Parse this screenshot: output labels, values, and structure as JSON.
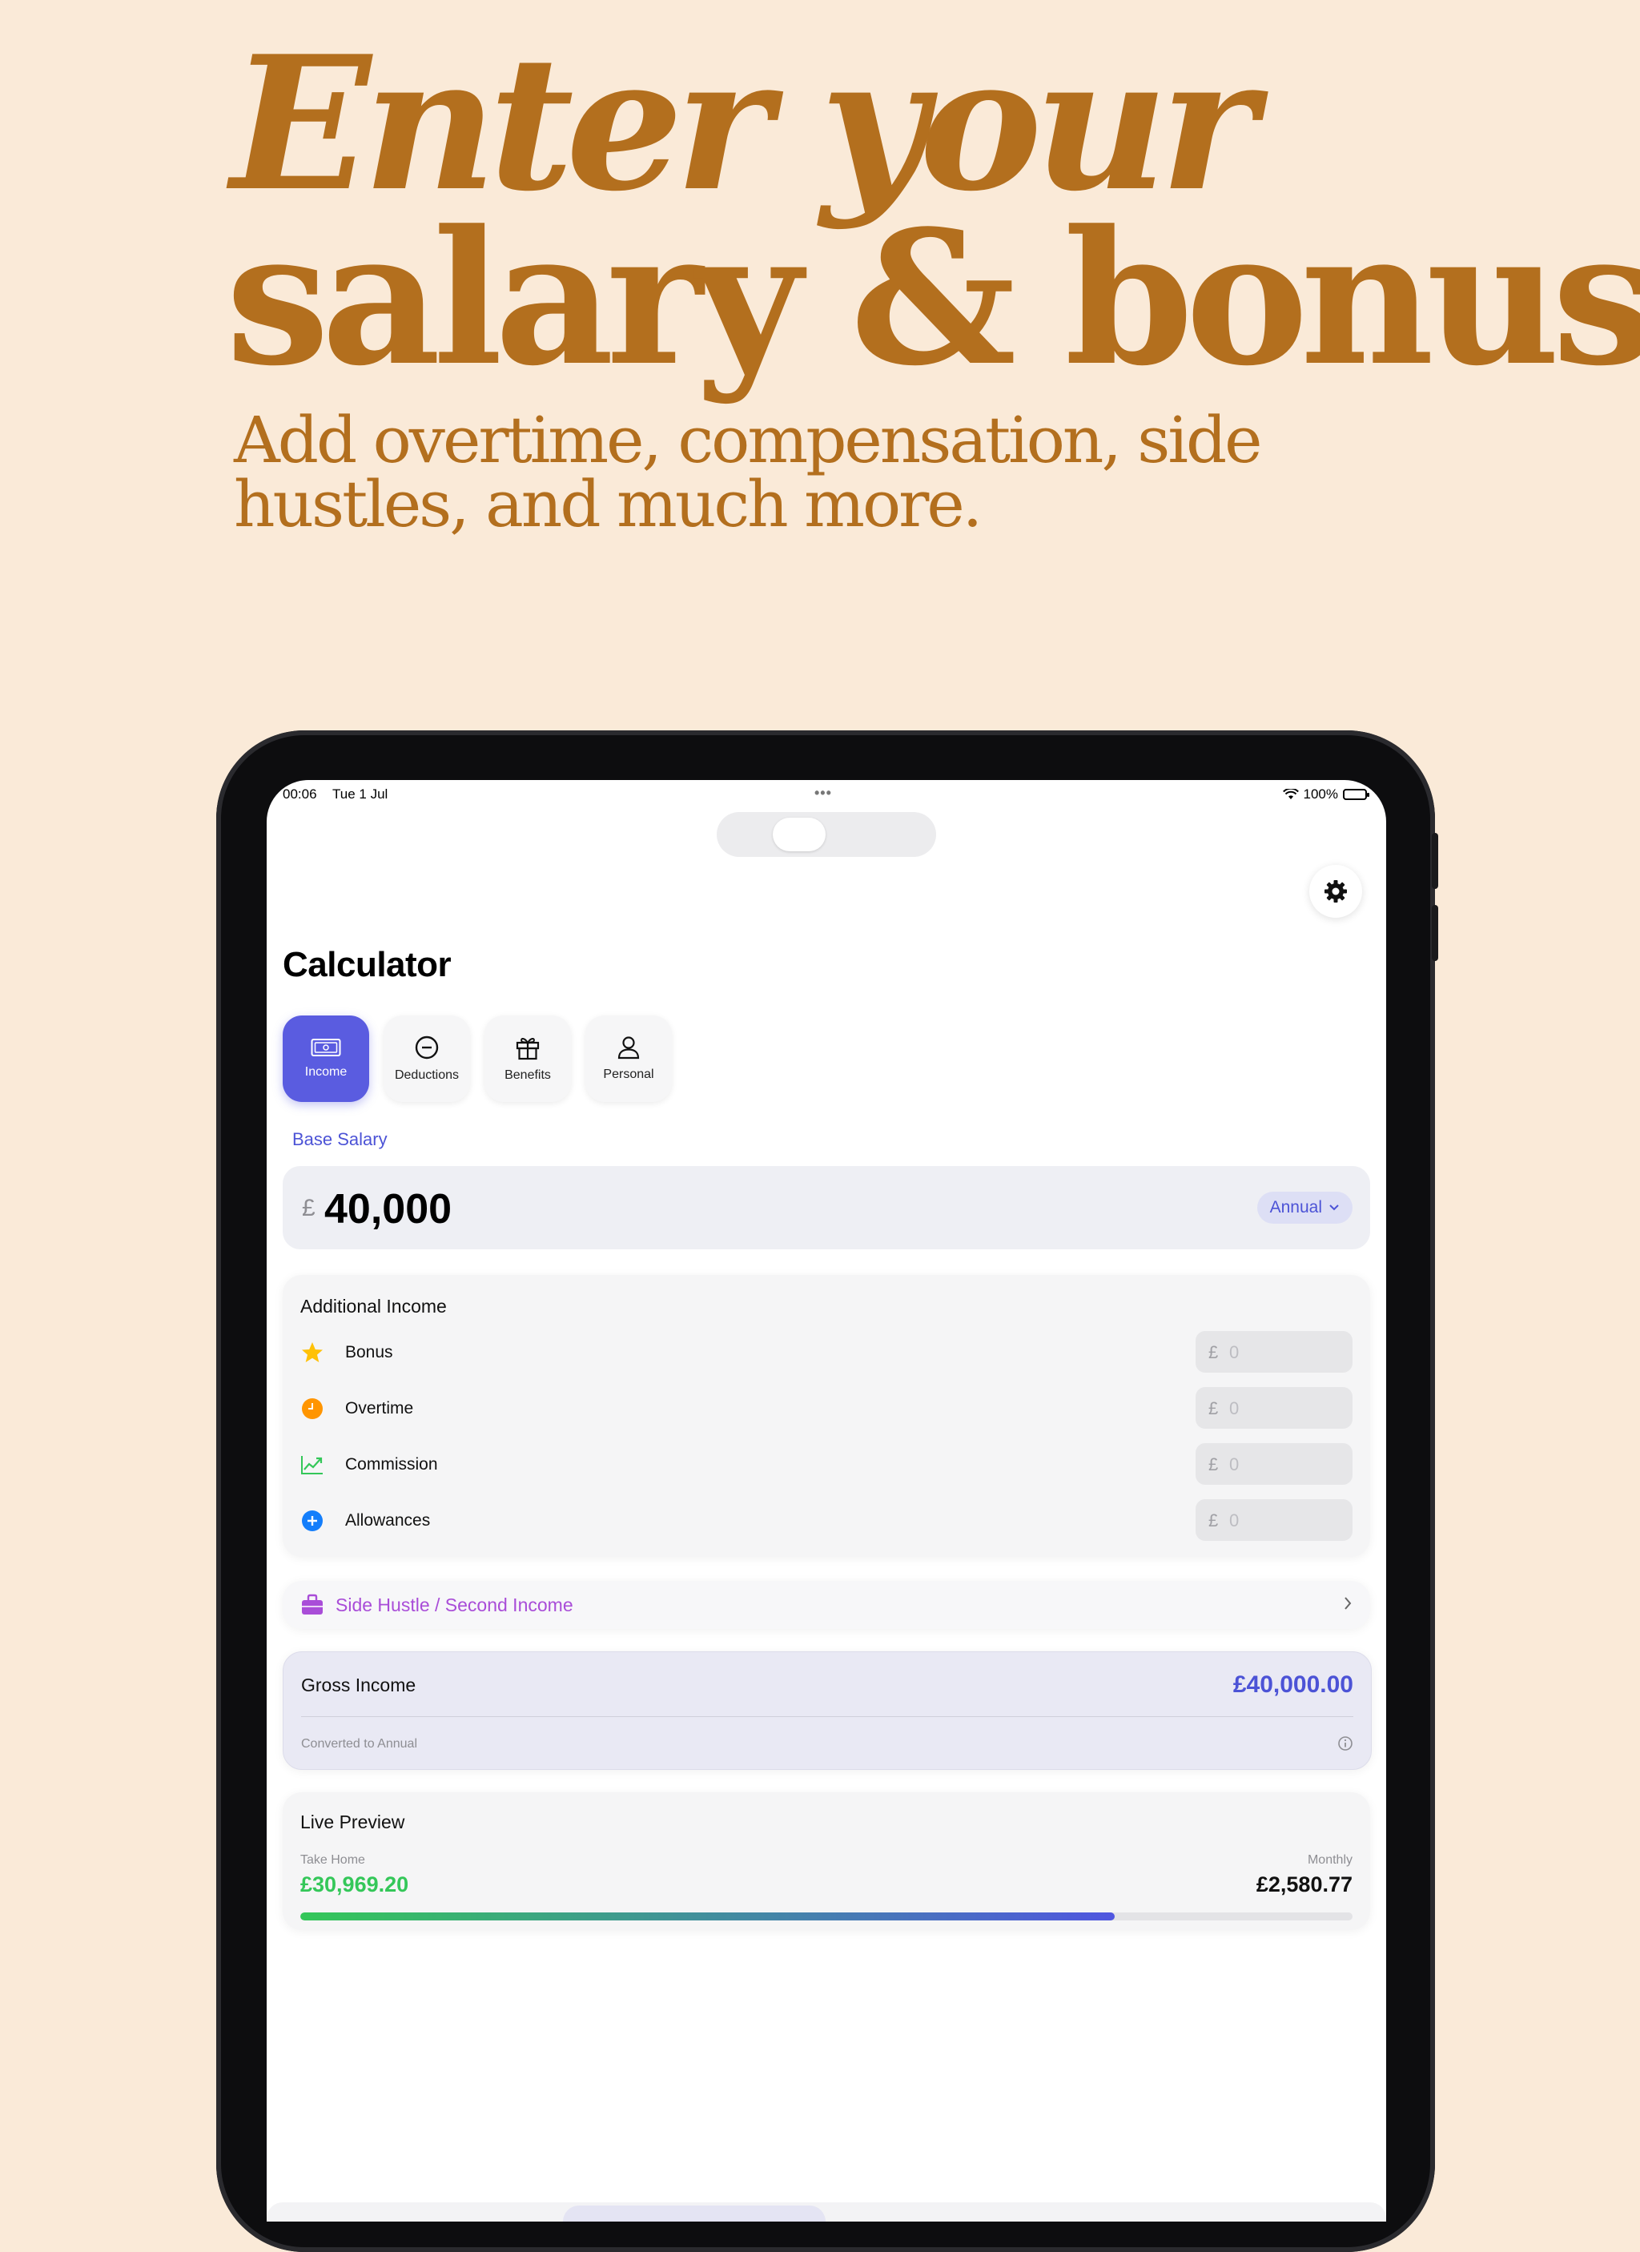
{
  "headline": {
    "line1": "Enter your",
    "line2": "salary & bonus",
    "sub_line1": "Add overtime, compensation, side",
    "sub_line2": "hustles, and much more."
  },
  "status_bar": {
    "time": "00:06",
    "date": "Tue 1 Jul",
    "battery": "100%"
  },
  "page_title": "Calculator",
  "tabs": [
    {
      "label": "Income",
      "icon": "banknote-icon"
    },
    {
      "label": "Deductions",
      "icon": "minus-circle-icon"
    },
    {
      "label": "Benefits",
      "icon": "gift-icon"
    },
    {
      "label": "Personal",
      "icon": "person-icon"
    }
  ],
  "base_salary": {
    "label": "Base Salary",
    "currency": "£",
    "amount": "40,000",
    "period": "Annual"
  },
  "additional_income": {
    "title": "Additional Income",
    "rows": [
      {
        "label": "Bonus",
        "icon": "star-icon",
        "currency": "£",
        "placeholder": "0"
      },
      {
        "label": "Overtime",
        "icon": "clock-icon",
        "currency": "£",
        "placeholder": "0"
      },
      {
        "label": "Commission",
        "icon": "chart-up-icon",
        "currency": "£",
        "placeholder": "0"
      },
      {
        "label": "Allowances",
        "icon": "plus-circle-icon",
        "currency": "£",
        "placeholder": "0"
      }
    ]
  },
  "side_hustle": {
    "label": "Side Hustle / Second Income",
    "icon": "briefcase-icon"
  },
  "gross_income": {
    "label": "Gross Income",
    "value": "£40,000.00",
    "note": "Converted to Annual"
  },
  "live_preview": {
    "title": "Live Preview",
    "take_home_label": "Take Home",
    "take_home_value": "£30,969.20",
    "monthly_label": "Monthly",
    "monthly_value": "£2,580.77",
    "progress_fraction": 0.774
  },
  "colors": {
    "accent": "#5A5CE0",
    "headline": "#B36F1E",
    "background": "#FAEAD8",
    "green": "#34C759",
    "purple": "#A94DD8"
  }
}
